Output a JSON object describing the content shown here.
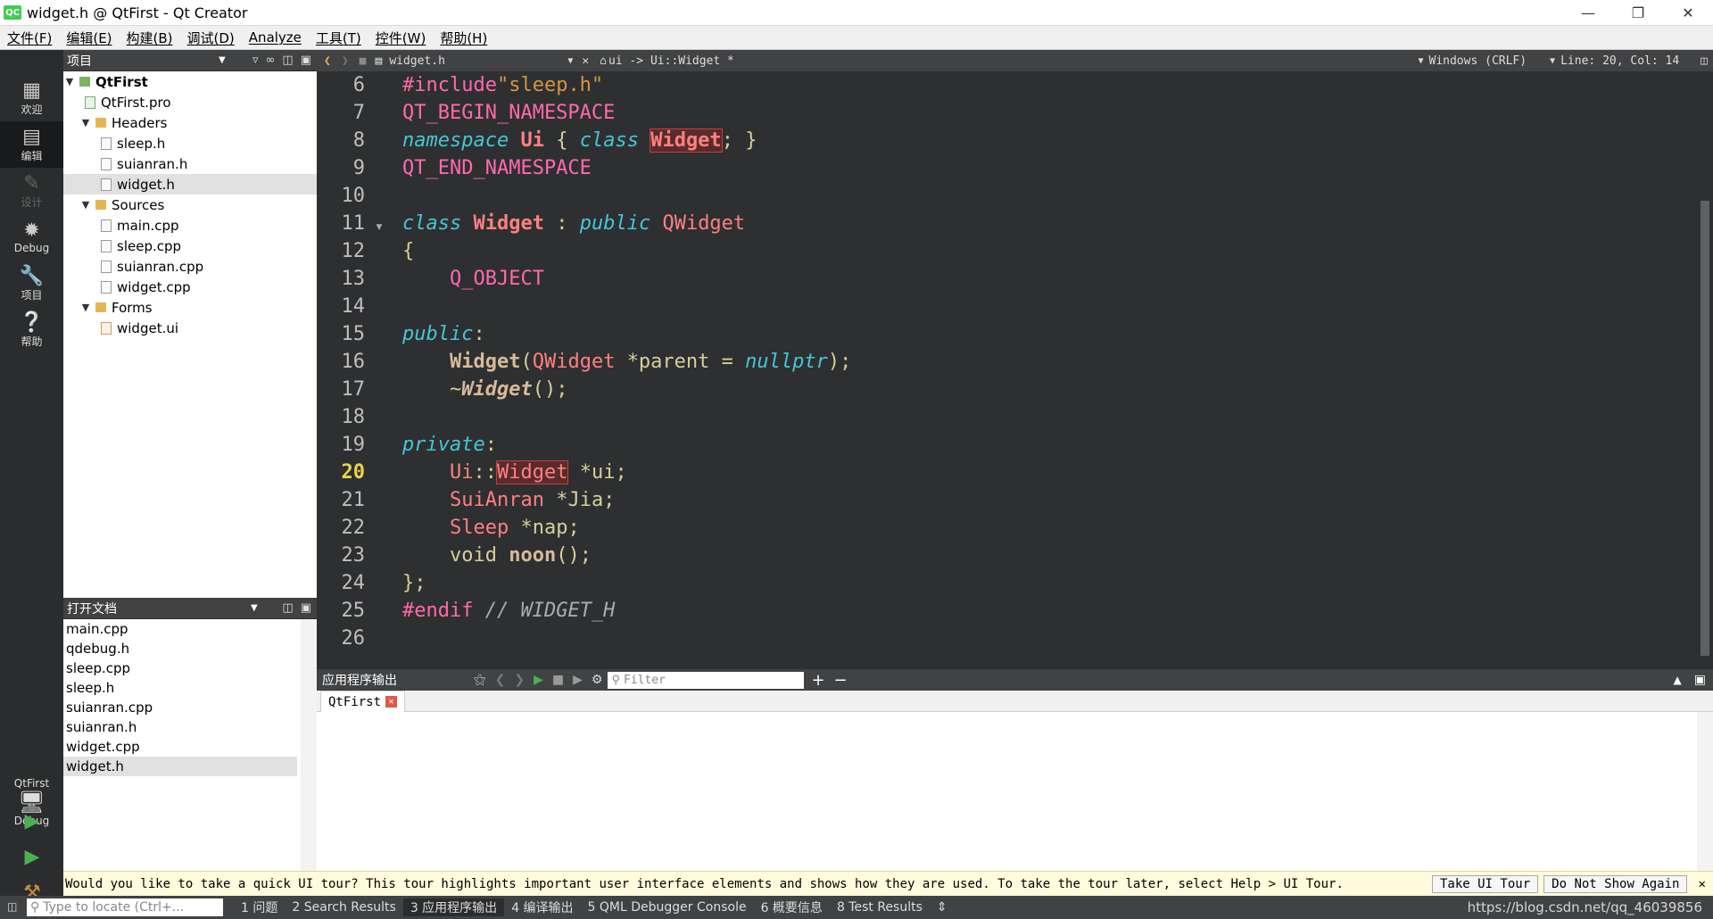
{
  "window": {
    "title": "widget.h @ QtFirst - Qt Creator",
    "app_icon_label": "QC"
  },
  "menu": [
    "文件(F)",
    "编辑(E)",
    "构建(B)",
    "调试(D)",
    "Analyze",
    "工具(T)",
    "控件(W)",
    "帮助(H)"
  ],
  "modes": [
    {
      "label": "欢迎",
      "icon": "grid-icon"
    },
    {
      "label": "编辑",
      "icon": "edit-icon",
      "active": true
    },
    {
      "label": "设计",
      "icon": "pencil-icon",
      "disabled": true
    },
    {
      "label": "Debug",
      "icon": "bug-icon"
    },
    {
      "label": "项目",
      "icon": "wrench-icon"
    },
    {
      "label": "帮助",
      "icon": "help-icon"
    }
  ],
  "kit": {
    "project": "QtFirst",
    "mode": "Debug"
  },
  "project_panel": {
    "title": "项目"
  },
  "tree": {
    "root": "QtFirst",
    "pro": "QtFirst.pro",
    "headers_label": "Headers",
    "headers": [
      "sleep.h",
      "suianran.h",
      "widget.h"
    ],
    "sources_label": "Sources",
    "sources": [
      "main.cpp",
      "sleep.cpp",
      "suianran.cpp",
      "widget.cpp"
    ],
    "forms_label": "Forms",
    "forms": [
      "widget.ui"
    ],
    "selected": "widget.h"
  },
  "open_docs": {
    "title": "打开文档",
    "items": [
      "main.cpp",
      "qdebug.h",
      "sleep.cpp",
      "sleep.h",
      "suianran.cpp",
      "suianran.h",
      "widget.cpp",
      "widget.h"
    ],
    "selected": "widget.h"
  },
  "editor_bar": {
    "file": "widget.h",
    "symbol": "ui -> Ui::Widget *",
    "encoding": "Windows (CRLF)",
    "position": "Line: 20, Col: 14"
  },
  "editor": {
    "line_numbers": [
      "6",
      "7",
      "8",
      "9",
      "10",
      "11",
      "12",
      "13",
      "14",
      "15",
      "16",
      "17",
      "18",
      "19",
      "20",
      "21",
      "22",
      "23",
      "24",
      "25",
      "26"
    ],
    "current_line": "20"
  },
  "output": {
    "title": "应用程序输出",
    "filter_placeholder": "Filter",
    "tab": "QtFirst"
  },
  "tour": {
    "message": "Would you like to take a quick UI tour? This tour highlights important user interface elements and shows how they are used. To take the tour later, select Help > UI Tour.",
    "take_label": "Take UI Tour",
    "dismiss_label": "Do Not Show Again"
  },
  "status": {
    "locator_placeholder": "Type to locate (Ctrl+...",
    "panes": [
      "1 问题",
      "2 Search Results",
      "3 应用程序输出",
      "4 编译输出",
      "5 QML Debugger Console",
      "6 概要信息",
      "8 Test Results"
    ]
  },
  "watermark": "https://blog.csdn.net/qq_46039856"
}
